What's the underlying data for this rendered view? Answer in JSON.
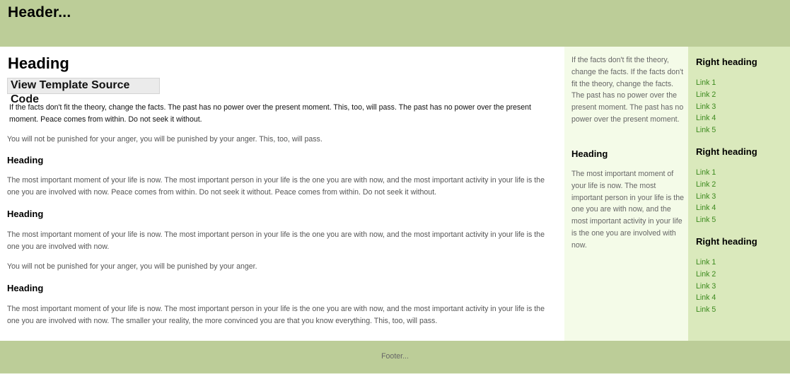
{
  "header": {
    "title": "Header..."
  },
  "main": {
    "heading": "Heading",
    "source_button": "View Template Source Code",
    "intro_paragraph": "If the facts don't fit the theory, change the facts. The past has no power over the present moment. This, too, will pass. The past has no power over the present moment. Peace comes from within. Do not seek it without.",
    "paragraph_2": "You will not be punished for your anger, you will be punished by your anger. This, too, will pass.",
    "sections": [
      {
        "heading": "Heading",
        "paragraphs": [
          "The most important moment of your life is now. The most important person in your life is the one you are with now, and the most important activity in your life is the one you are involved with now. Peace comes from within. Do not seek it without. Peace comes from within. Do not seek it without."
        ]
      },
      {
        "heading": "Heading",
        "paragraphs": [
          "The most important moment of your life is now. The most important person in your life is the one you are with now, and the most important activity in your life is the one you are involved with now.",
          "You will not be punished for your anger, you will be punished by your anger."
        ]
      },
      {
        "heading": "Heading",
        "paragraphs": [
          "The most important moment of your life is now. The most important person in your life is the one you are with now, and the most important activity in your life is the one you are involved with now. The smaller your reality, the more convinced you are that you know everything. This, too, will pass."
        ]
      }
    ]
  },
  "middle_sidebar": {
    "paragraph_1": "If the facts don't fit the theory, change the facts. If the facts don't fit the theory, change the facts. The past has no power over the present moment. The past has no power over the present moment.",
    "heading": "Heading",
    "paragraph_2": "The most important moment of your life is now. The most important person in your life is the one you are with now, and the most important activity in your life is the one you are involved with now."
  },
  "right_sidebar": {
    "groups": [
      {
        "heading": "Right heading",
        "links": [
          "Link 1",
          "Link 2",
          "Link 3",
          "Link 4",
          "Link 5"
        ]
      },
      {
        "heading": "Right heading",
        "links": [
          "Link 1",
          "Link 2",
          "Link 3",
          "Link 4",
          "Link 5"
        ]
      },
      {
        "heading": "Right heading",
        "links": [
          "Link 1",
          "Link 2",
          "Link 3",
          "Link 4",
          "Link 5"
        ]
      }
    ]
  },
  "footer": {
    "text": "Footer..."
  },
  "colors": {
    "header_footer_bg": "#bccd98",
    "middle_sidebar_bg": "#f4fbe8",
    "right_sidebar_bg": "#dae9bc",
    "link": "#3c8a1e"
  }
}
